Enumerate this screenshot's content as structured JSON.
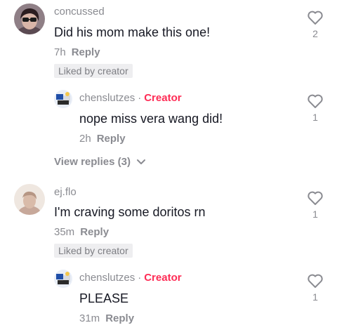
{
  "comments": [
    {
      "username": "concussed",
      "text": "Did his mom make this one!",
      "time": "7h",
      "reply_label": "Reply",
      "liked_badge": "Liked by creator",
      "likes": "2",
      "reply": {
        "username": "chenslutzes",
        "separator": "·",
        "creator_label": "Creator",
        "text": "nope miss vera wang did!",
        "time": "2h",
        "reply_label": "Reply",
        "likes": "1"
      },
      "view_replies": "View replies (3)"
    },
    {
      "username": "ej.flo",
      "text": "I'm craving some doritos rn",
      "time": "35m",
      "reply_label": "Reply",
      "liked_badge": "Liked by creator",
      "likes": "1",
      "reply": {
        "username": "chenslutzes",
        "separator": "·",
        "creator_label": "Creator",
        "text": "PLEASE",
        "time": "31m",
        "reply_label": "Reply",
        "likes": "1"
      }
    }
  ],
  "colors": {
    "creator_accent": "#fe2c55",
    "meta_gray": "#8a8b91",
    "badge_bg": "#eeeef0"
  },
  "icons": {
    "like": "heart-outline-icon",
    "expand": "chevron-down-icon"
  }
}
